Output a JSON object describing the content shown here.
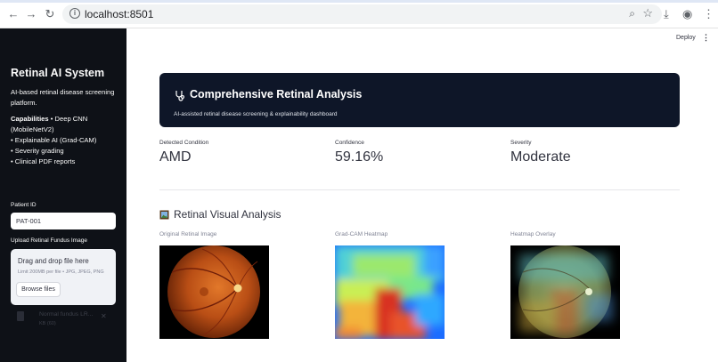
{
  "browser": {
    "url": "localhost:8501"
  },
  "header": {
    "deploy_label": "Deploy",
    "menu_icon": "kebab-menu-icon"
  },
  "sidebar": {
    "title": "Retinal AI System",
    "description": "AI-based retinal disease screening platform.",
    "capabilities_heading": "Capabilities",
    "capabilities": [
      "• Deep CNN (MobileNetV2)",
      "• Explainable AI (Grad-CAM)",
      "• Severity grading",
      "• Clinical PDF reports"
    ],
    "patient_id_label": "Patient ID",
    "patient_id_value": "PAT-001",
    "upload_label": "Upload Retinal Fundus Image",
    "uploader": {
      "drag_text": "Drag and drop file here",
      "limit_text": "Limit 200MB per file • JPG, JPEG, PNG",
      "browse_label": "Browse files"
    },
    "file": {
      "name": "Normal fundus LR...",
      "size": "KB (60)"
    }
  },
  "banner": {
    "title": "Comprehensive Retinal Analysis",
    "subtitle": "AI-assisted retinal disease screening & explainability dashboard",
    "icon": "stethoscope-icon"
  },
  "metrics": [
    {
      "label": "Detected Condition",
      "value": "AMD"
    },
    {
      "label": "Confidence",
      "value": "59.16%"
    },
    {
      "label": "Severity",
      "value": "Moderate"
    }
  ],
  "visual": {
    "title": "Retinal Visual Analysis",
    "icon": "picture-frame-icon",
    "images": [
      {
        "label": "Original Retinal Image"
      },
      {
        "label": "Grad-CAM Heatmap"
      },
      {
        "label": "Heatmap Overlay"
      }
    ]
  },
  "colors": {
    "sidebar_bg": "#0e1117",
    "banner_bg": "#0e1628",
    "text": "#31333f"
  }
}
